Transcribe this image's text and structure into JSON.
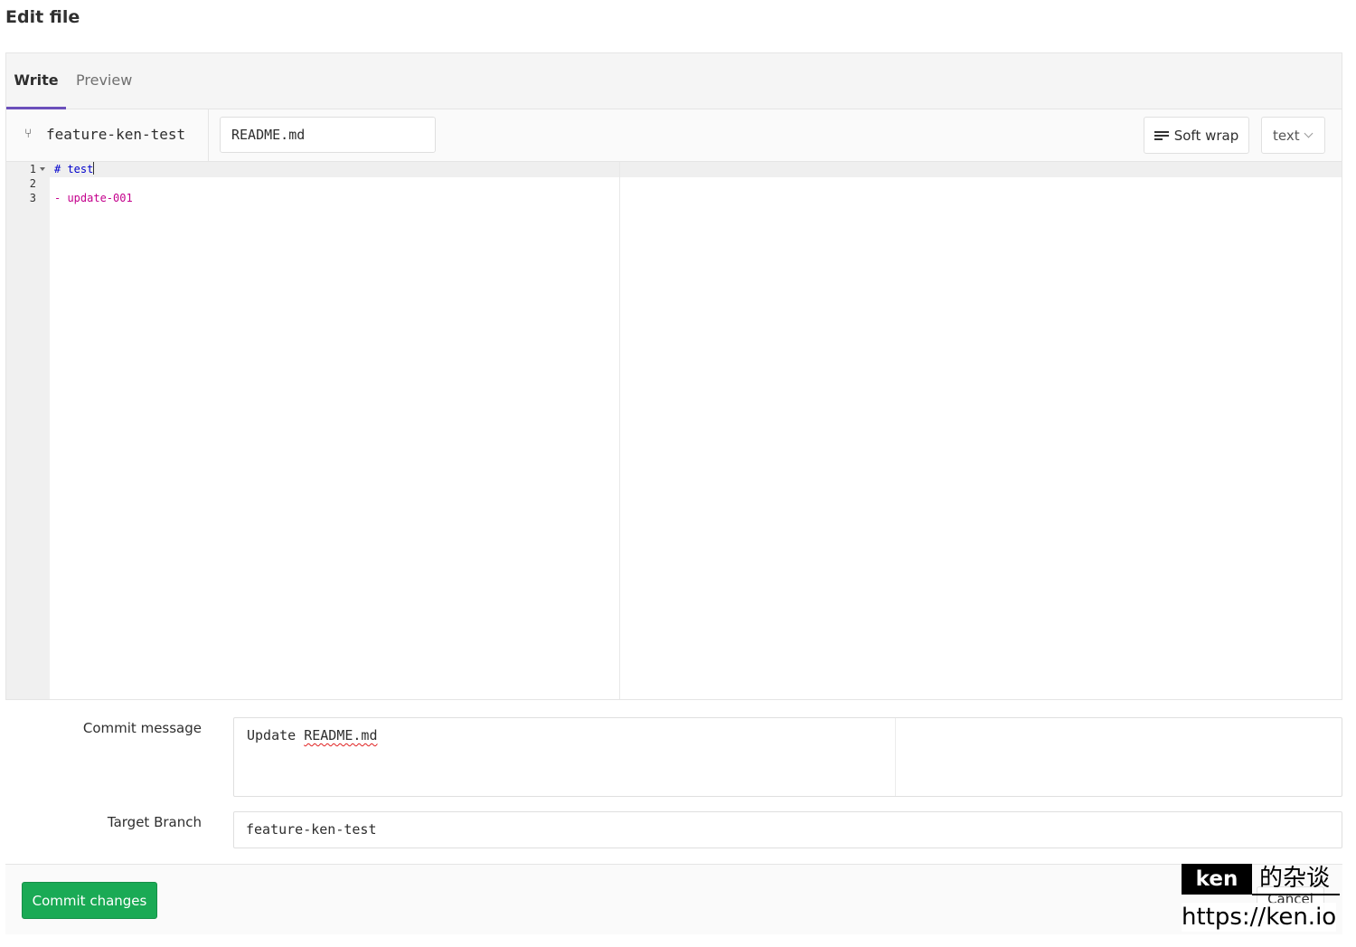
{
  "page": {
    "title": "Edit file"
  },
  "tabs": [
    {
      "label": "Write",
      "active": true
    },
    {
      "label": "Preview",
      "active": false
    }
  ],
  "file_bar": {
    "branch_icon": "branch-icon",
    "branch": "feature-ken-test",
    "filename": "README.md",
    "soft_wrap_label": "Soft wrap",
    "mode": "text"
  },
  "editor": {
    "lines": [
      {
        "number": "1",
        "text": "# test"
      },
      {
        "number": "2",
        "text": ""
      },
      {
        "number": "3",
        "text": "- update-001"
      }
    ]
  },
  "commit": {
    "message_label": "Commit message",
    "message_prefix": "Update ",
    "message_file": "README.md",
    "target_label": "Target Branch",
    "target_branch": "feature-ken-test"
  },
  "actions": {
    "commit_label": "Commit changes",
    "cancel_label": "Cancel"
  },
  "watermark": {
    "name": "ken",
    "suffix": "的杂谈",
    "url": "https://ken.io"
  },
  "colors": {
    "accent": "#6b4fbb",
    "commit_button": "#1aaa55",
    "heading_token": "#0000cc",
    "list_token": "#c4008c"
  }
}
